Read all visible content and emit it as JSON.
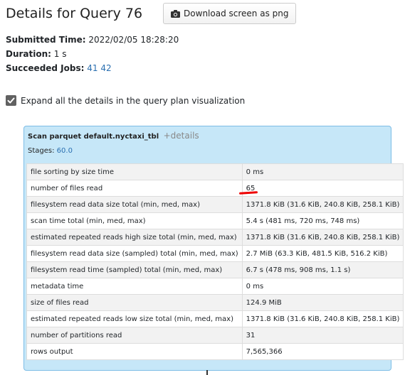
{
  "header": {
    "title": "Details for Query 76",
    "download_label": "Download screen as png"
  },
  "summary": {
    "submitted_label": "Submitted Time:",
    "submitted_value": "2022/02/05 18:28:20",
    "duration_label": "Duration:",
    "duration_value": "1 s",
    "jobs_label": "Succeeded Jobs:",
    "jobs": [
      "41",
      "42"
    ]
  },
  "expand": {
    "label": "Expand all the details in the query plan visualization",
    "checked": true
  },
  "node": {
    "title": "Scan parquet default.nyctaxi_tbl",
    "details_link": "+details",
    "stages_label": "Stages:",
    "stages_value": "60.0",
    "metrics": [
      {
        "name": "file sorting by size time",
        "value": "0 ms"
      },
      {
        "name": "number of files read",
        "value": "65"
      },
      {
        "name": "filesystem read data size total (min, med, max)",
        "value": "1371.8 KiB (31.6 KiB, 240.8 KiB, 258.1 KiB)"
      },
      {
        "name": "scan time total (min, med, max)",
        "value": "5.4 s (481 ms, 720 ms, 748 ms)"
      },
      {
        "name": "estimated repeated reads high size total (min, med, max)",
        "value": "1371.8 KiB (31.6 KiB, 240.8 KiB, 258.1 KiB)"
      },
      {
        "name": "filesystem read data size (sampled) total (min, med, max)",
        "value": "2.7 MiB (63.3 KiB, 481.5 KiB, 516.2 KiB)"
      },
      {
        "name": "filesystem read time (sampled) total (min, med, max)",
        "value": "6.7 s (478 ms, 908 ms, 1.1 s)"
      },
      {
        "name": "metadata time",
        "value": "0 ms"
      },
      {
        "name": "size of files read",
        "value": "124.9 MiB"
      },
      {
        "name": "estimated repeated reads low size total (min, med, max)",
        "value": "1371.8 KiB (31.6 KiB, 240.8 KiB, 258.1 KiB)"
      },
      {
        "name": "number of partitions read",
        "value": "31"
      },
      {
        "name": "rows output",
        "value": "7,565,366"
      }
    ]
  },
  "colors": {
    "node_bg": "#c6e7f8",
    "node_border": "#7dbde6",
    "link": "#2a6fb0",
    "annotation": "#e00000"
  },
  "icons": {
    "download": "camera-icon",
    "checkbox": "checkmark-icon"
  }
}
